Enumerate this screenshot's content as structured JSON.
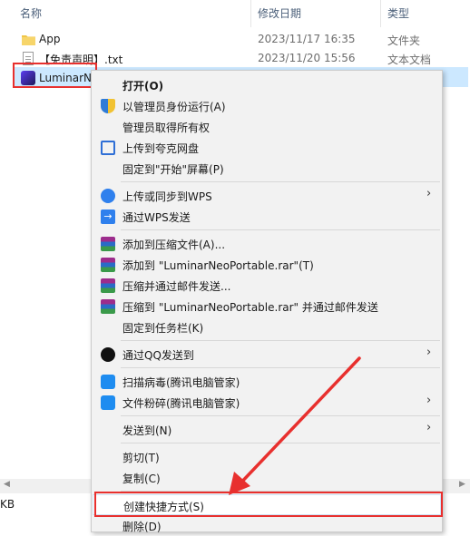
{
  "explorer": {
    "columns": {
      "name": "名称",
      "date": "修改日期",
      "type": "类型"
    },
    "files": [
      {
        "name": "App",
        "date": "2023/11/17 16:35",
        "type": "文件夹",
        "icon": "folder-icon"
      },
      {
        "name": "【免责声明】.txt",
        "date": "2023/11/20 15:56",
        "type": "文本文档",
        "icon": "txt-file-icon"
      }
    ],
    "selected_file": {
      "name": "LuminarN",
      "icon": "luminar-app-icon"
    },
    "status_size": "KB"
  },
  "context_menu": {
    "items": [
      {
        "label": "打开(O)",
        "icon": "",
        "bold": true
      },
      {
        "label": "以管理员身份运行(A)",
        "icon": "uac-shield-icon"
      },
      {
        "label": "管理员取得所有权",
        "icon": ""
      },
      {
        "label": "上传到夸克网盘",
        "icon": "quark-icon"
      },
      {
        "label": "固定到\"开始\"屏幕(P)",
        "icon": ""
      },
      {
        "label": "上传或同步到WPS",
        "icon": "wps-cloud-icon",
        "submenu": true
      },
      {
        "label": "通过WPS发送",
        "icon": "wps-send-icon"
      },
      {
        "label": "添加到压缩文件(A)...",
        "icon": "winrar-icon"
      },
      {
        "label": "添加到 \"LuminarNeoPortable.rar\"(T)",
        "icon": "winrar-icon"
      },
      {
        "label": "压缩并通过邮件发送...",
        "icon": "winrar-icon"
      },
      {
        "label": "压缩到 \"LuminarNeoPortable.rar\" 并通过邮件发送",
        "icon": "winrar-icon"
      },
      {
        "label": "固定到任务栏(K)",
        "icon": ""
      },
      {
        "label": "通过QQ发送到",
        "icon": "qq-icon",
        "submenu": true
      },
      {
        "label": "扫描病毒(腾讯电脑管家)",
        "icon": "tencent-pc-manager-icon"
      },
      {
        "label": "文件粉碎(腾讯电脑管家)",
        "icon": "tencent-pc-manager-icon",
        "submenu": true
      },
      {
        "label": "发送到(N)",
        "icon": "",
        "submenu": true
      },
      {
        "label": "剪切(T)",
        "icon": ""
      },
      {
        "label": "复制(C)",
        "icon": ""
      },
      {
        "label": "创建快捷方式(S)",
        "icon": "",
        "highlighted": true
      },
      {
        "label": "删除(D)",
        "icon": ""
      }
    ]
  },
  "colors": {
    "annotation_red": "#e8302e",
    "selection_blue": "#cce8ff",
    "menu_background": "#f2f2f2"
  }
}
